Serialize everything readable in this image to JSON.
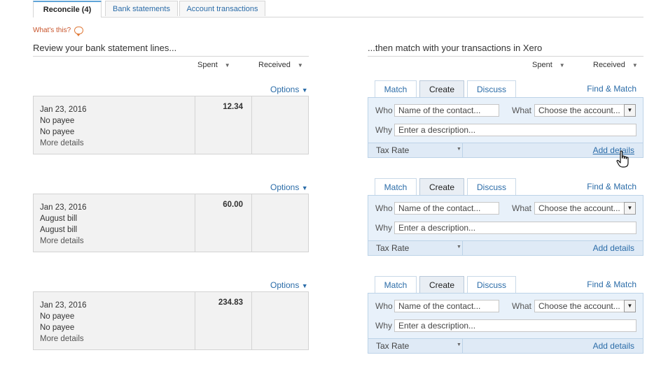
{
  "tabs": [
    {
      "label": "Reconcile (4)",
      "active": true
    },
    {
      "label": "Bank statements",
      "active": false
    },
    {
      "label": "Account transactions",
      "active": false
    }
  ],
  "whats_this": "What's this?",
  "left_heading": "Review your bank statement lines...",
  "right_heading": "...then match with your transactions in Xero",
  "columns": {
    "spent": "Spent",
    "received": "Received"
  },
  "options_label": "Options",
  "match_tabs": {
    "match": "Match",
    "create": "Create",
    "discuss": "Discuss"
  },
  "find_match": "Find & Match",
  "form": {
    "who_label": "Who",
    "who_placeholder": "Name of the contact...",
    "what_label": "What",
    "what_placeholder": "Choose the account...",
    "why_label": "Why",
    "why_placeholder": "Enter a description...",
    "tax_rate": "Tax Rate",
    "add_details": "Add details"
  },
  "lines": [
    {
      "date": "Jan 23, 2016",
      "payee": "No payee",
      "reference": "No payee",
      "more": "More details",
      "spent": "12.34",
      "received": ""
    },
    {
      "date": "Jan 23, 2016",
      "payee": "August bill",
      "reference": "August bill",
      "more": "More details",
      "spent": "60.00",
      "received": ""
    },
    {
      "date": "Jan 23, 2016",
      "payee": "No payee",
      "reference": "No payee",
      "more": "More details",
      "spent": "234.83",
      "received": ""
    }
  ],
  "colors": {
    "link": "#2b6ca8",
    "panel_bg": "#e8f1fa",
    "whats_this": "#c8542b"
  }
}
